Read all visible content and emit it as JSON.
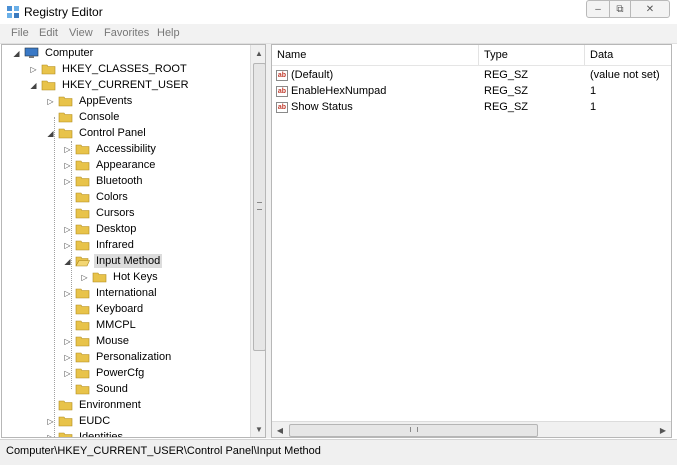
{
  "window": {
    "title": "Registry Editor"
  },
  "menu": [
    "File",
    "Edit",
    "View",
    "Favorites",
    "Help"
  ],
  "tree": {
    "root": "Computer",
    "hkcr": "HKEY_CLASSES_ROOT",
    "hkcu": "HKEY_CURRENT_USER",
    "hkcu_children": {
      "appevents": "AppEvents",
      "console": "Console",
      "control_panel": "Control Panel",
      "environment": "Environment",
      "eudc": "EUDC",
      "identities": "Identities"
    },
    "control_panel_children": {
      "accessibility": "Accessibility",
      "appearance": "Appearance",
      "bluetooth": "Bluetooth",
      "colors": "Colors",
      "cursors": "Cursors",
      "desktop": "Desktop",
      "infrared": "Infrared",
      "input_method": "Input Method",
      "international": "International",
      "keyboard": "Keyboard",
      "mmcpl": "MMCPL",
      "mouse": "Mouse",
      "personalization": "Personalization",
      "powercfg": "PowerCfg",
      "sound": "Sound"
    },
    "input_method_children": {
      "hot_keys": "Hot Keys"
    }
  },
  "list": {
    "columns": {
      "name": "Name",
      "type": "Type",
      "data": "Data"
    },
    "rows": [
      {
        "name": "(Default)",
        "type": "REG_SZ",
        "data": "(value not set)",
        "icon": "ab"
      },
      {
        "name": "EnableHexNumpad",
        "type": "REG_SZ",
        "data": "1",
        "icon": "ab"
      },
      {
        "name": "Show Status",
        "type": "REG_SZ",
        "data": "1",
        "icon": "ab"
      }
    ]
  },
  "status": {
    "path": "Computer\\HKEY_CURRENT_USER\\Control Panel\\Input Method"
  },
  "colors": {
    "folder": "#e8c34a",
    "selected": "#dcdcdc",
    "value_icon": "#c0392b"
  }
}
